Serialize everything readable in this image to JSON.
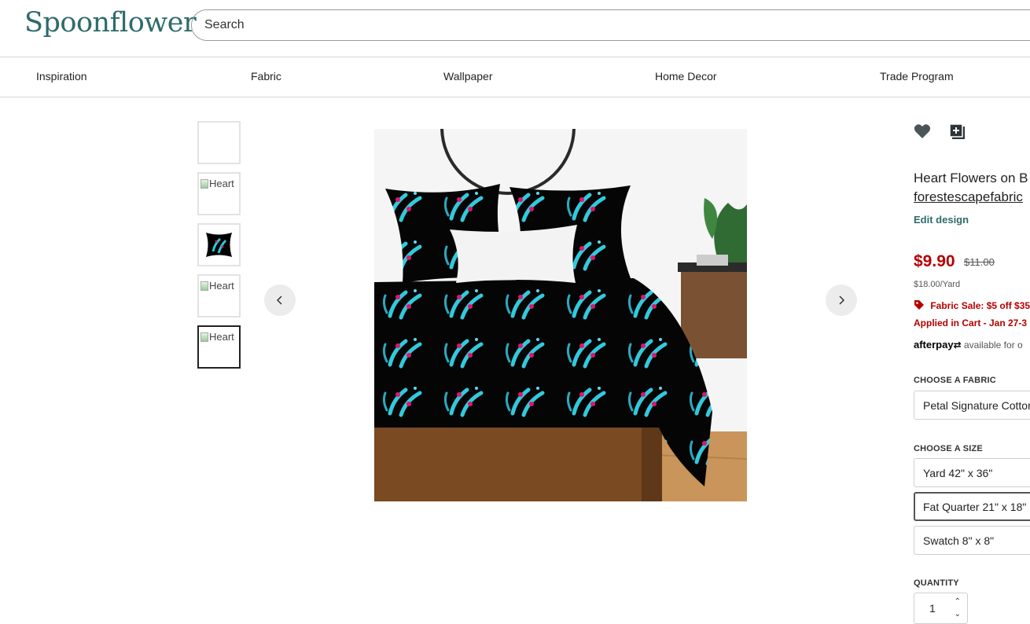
{
  "header": {
    "logo": "Spoonflower",
    "search_placeholder": "Search"
  },
  "nav": [
    "Inspiration",
    "Fabric",
    "Wallpaper",
    "Home Decor",
    "Trade Program"
  ],
  "thumbs": {
    "alt_text": "Heart"
  },
  "product": {
    "title": "Heart Flowers on B",
    "author": "forestescapefabric",
    "edit_link": "Edit design",
    "price": "$9.90",
    "old_price": "$11.00",
    "per_yard": "$18.00/Yard",
    "sale_text": "Fabric Sale: $5 off $35",
    "sale_applied": "Applied in Cart - Jan 27-3",
    "afterpay_brand": "afterpay",
    "afterpay_text": "available for o"
  },
  "fabric": {
    "label": "CHOOSE A FABRIC",
    "value": "Petal Signature Cotton"
  },
  "size": {
    "label": "CHOOSE A SIZE",
    "options": [
      "Yard 42\" x 36\"",
      "Fat Quarter 21\" x 18\"",
      "Swatch 8\" x 8\""
    ],
    "selected": "Fat Quarter 21\" x 18\""
  },
  "quantity": {
    "label": "QUANTITY",
    "value": "1"
  },
  "colors": {
    "brand": "#2e6b6b",
    "sale": "#b50000"
  },
  "icons": [
    "heart-icon",
    "add-to-collection-icon",
    "chevron-left-icon",
    "chevron-right-icon",
    "tag-icon"
  ]
}
